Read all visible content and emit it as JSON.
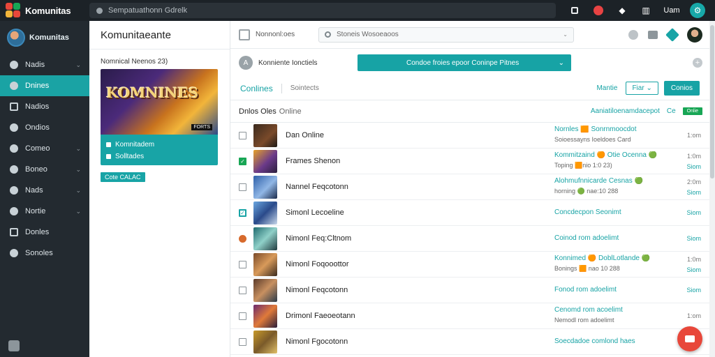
{
  "app": {
    "title": "Komunitas",
    "top_search_placeholder": "Sempatuathonn Gdrelk",
    "top_text": "Uam",
    "colors": {
      "accent": "#17a3a5",
      "nav_bg": "#232a30",
      "topbar_bg": "#1c2227",
      "fab": "#e8473a",
      "green": "#18a655"
    }
  },
  "sidebar": {
    "profile_name": "Komunitas",
    "items": [
      {
        "label": "Nadis",
        "icon": "circle-icon",
        "chevron": "⌄"
      },
      {
        "label": "Dnines",
        "icon": "bolt-icon",
        "chevron": ""
      },
      {
        "label": "Nadios",
        "icon": "square-icon",
        "chevron": ""
      },
      {
        "label": "Ondios",
        "icon": "circle-icon",
        "chevron": ""
      },
      {
        "label": "Comeo",
        "icon": "folder-icon",
        "chevron": "⌄"
      },
      {
        "label": "Boneo",
        "icon": "link-icon",
        "chevron": "⌄"
      },
      {
        "label": "Nads",
        "icon": "mail-icon",
        "chevron": "⌄"
      },
      {
        "label": "Nortie",
        "icon": "gamepad-icon",
        "chevron": "⌄"
      },
      {
        "label": "Donles",
        "icon": "box-icon",
        "chevron": ""
      },
      {
        "label": "Sonoles",
        "icon": "globe-icon",
        "chevron": ""
      }
    ]
  },
  "community": {
    "title": "Komunitaeante",
    "label": "Nomnical Neenos 23)",
    "game_logo": "KOMNINES",
    "game_badge": "FORTS",
    "info_line1": "Komnitadem",
    "info_line2": "Solltades",
    "tag": "Cote CALAC"
  },
  "main": {
    "top_label": "Nonnonl:oes",
    "search_placeholder": "Stoneis Wosoeaoos",
    "row2_label": "Konniente Ionctiels",
    "select_value": "Condoe froies epoor Coninpe Pitnes",
    "tabs": {
      "active": "Conlines",
      "inactive": "Sointects"
    },
    "right_name": "Mantie",
    "filter_label": "Fiar",
    "primary_label": "Conios",
    "list_header": {
      "bold": "Dnlos Oles",
      "rest": "Online",
      "link": "Aaniatiloenamdacepot",
      "link2": "Ce",
      "pill": "Onlie"
    },
    "rows": [
      {
        "check": "none",
        "name": "Dan Online",
        "meta1": "Nornles 🟧 Sonrnmoocdot",
        "meta2": "Soioessayns Ioeldoes Card",
        "time1": "1:om",
        "time2": "",
        "thumb": "linear-gradient(135deg,#3a2a1e,#7a4a2a 60%,#1d1a16)"
      },
      {
        "check": "green",
        "name": "Frames Shenon",
        "meta1": "Kommitzaind 🟠 Otie Ocenna 🟢",
        "meta2": "Toping 🟧nio 1:0 23)",
        "time1": "1:0m",
        "time2": "Siom",
        "thumb": "linear-gradient(135deg,#e6a12a,#6b3a8a 55%,#2a1e3c)"
      },
      {
        "check": "none",
        "name": "Nannel Feqcotonn",
        "meta1": "Alohmufnnicarde Cesnas 🟢",
        "meta2": "horning 🟢 nae:10 288",
        "time1": "2:0m",
        "time2": "Siom",
        "thumb": "linear-gradient(135deg,#2d5fa8,#91b7e6 55%,#1a2a4a)"
      },
      {
        "check": "teal",
        "name": "Simonl Lecoeline",
        "meta1": "Concdecpon Seonimt",
        "meta2": "",
        "time1": "",
        "time2": "Siom",
        "thumb": "linear-gradient(135deg,#6aa6e0,#2a4a8a 50%,#c8d8ea)"
      },
      {
        "check": "orange",
        "name": "Nimonl Feq:Cltnom",
        "meta1": "Coinod rom adoelimt",
        "meta2": "",
        "time1": "",
        "time2": "Siom",
        "thumb": "linear-gradient(135deg,#1f6a6e,#8fd0c8 50%,#203a3e)"
      },
      {
        "check": "none",
        "name": "Nimonl Foqooottor",
        "meta1": "Konnimed 🟠 DoblLotlande 🟢",
        "meta2": "Bonings 🟧 nao 10 288",
        "time1": "1:0m",
        "time2": "Siom",
        "thumb": "linear-gradient(135deg,#7a4a2a,#d89a5a 50%,#3a2a1e)"
      },
      {
        "check": "none",
        "name": "Nimonl Feqcotonn",
        "meta1": "Fonod rom adoelimt",
        "meta2": "",
        "time1": "",
        "time2": "Siom",
        "thumb": "linear-gradient(135deg,#5a3a2a,#c89060 50%,#2a3a4a)"
      },
      {
        "check": "none",
        "name": "Drimonl Faeoeotann",
        "meta1": "Cenomd rom acoelimt",
        "meta2": "Nemodl rom adoelimt",
        "time1": "1:om",
        "time2": "",
        "thumb": "linear-gradient(135deg,#6a2a6e,#e07a3a 50%,#2a1e3a)"
      },
      {
        "check": "none",
        "name": "Nimonl Fgocotonn",
        "meta1": "Soecdadoe comlond haes",
        "meta2": "",
        "time1": "",
        "time2": "",
        "thumb": "linear-gradient(135deg,#c89a2a,#7a5a2a 50%,#e0c06a)"
      }
    ]
  }
}
